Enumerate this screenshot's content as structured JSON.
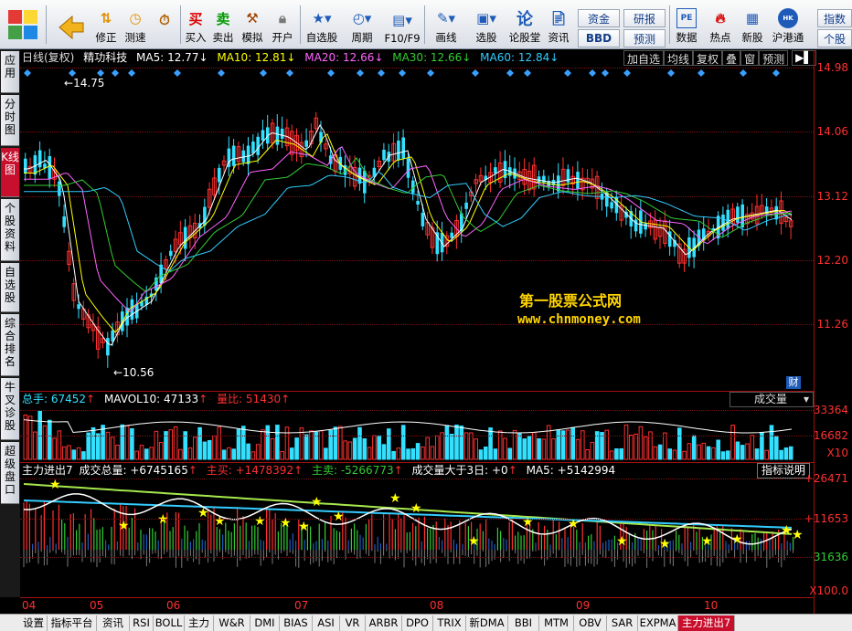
{
  "toolbar": {
    "buttons": [
      {
        "label": "修正",
        "icon": "arrow-updown-icon"
      },
      {
        "label": "测速",
        "icon": "speed-icon"
      },
      {
        "label": "买入",
        "icon": "buy-icon"
      },
      {
        "label": "卖出",
        "icon": "sell-icon"
      },
      {
        "label": "模拟",
        "icon": "hammer-icon"
      },
      {
        "label": "开户",
        "icon": "lock-icon"
      },
      {
        "label": "自选股",
        "icon": "star-icon"
      },
      {
        "label": "周期",
        "icon": "clock-icon"
      },
      {
        "label": "F10/F9",
        "icon": "f10-icon"
      },
      {
        "label": "画线",
        "icon": "pen-icon"
      },
      {
        "label": "选股",
        "icon": "screen-icon"
      },
      {
        "label": "论股堂",
        "icon": "forum-icon"
      },
      {
        "label": "资讯",
        "icon": "news-icon"
      },
      {
        "label": "数据",
        "icon": "pe-icon"
      },
      {
        "label": "热点",
        "icon": "hot-icon"
      },
      {
        "label": "新股",
        "icon": "new-stock-icon"
      },
      {
        "label": "沪港通",
        "icon": "sse-hkex-icon"
      }
    ],
    "box_zijin": "资金",
    "box_bbd": "BBD",
    "box_yanbao": "研报",
    "box_yuce": "预测",
    "box_zhishu": "指数",
    "box_gegu": "个股"
  },
  "left_tabs": [
    "应用",
    "分时图",
    "K线图",
    "个股资料",
    "自选股",
    "综合排名",
    "牛叉诊股",
    "超级盘口"
  ],
  "kline": {
    "header": {
      "period": "日线(复权)",
      "name": "精功科技",
      "ma5": "MA5: 12.77",
      "ma10": "MA10: 12.81",
      "ma20": "MA20: 12.66",
      "ma30": "MA30: 12.66",
      "ma60": "MA60: 12.84"
    },
    "right_buttons": [
      "加自选",
      "均线",
      "复权",
      "叠",
      "窗",
      "预测"
    ],
    "y_ticks": [
      "14.98",
      "14.06",
      "13.12",
      "12.20",
      "11.26"
    ],
    "high_label": "14.75",
    "low_label": "10.56",
    "watermark_title": "第一股票公式网",
    "watermark_url": "www.chnmoney.com",
    "cai_label": "财"
  },
  "volume": {
    "header": {
      "total": "总手: 67452",
      "mavol": "MAVOL10: 47133",
      "ratio": "量比: 51430"
    },
    "dropdown": "成交量",
    "y_ticks": [
      "33364",
      "16682",
      "X10"
    ]
  },
  "indicator": {
    "header": {
      "name": "主力进出7",
      "total": "成交总量: +6745165",
      "buy": "主买: +1478392",
      "sell": "主卖: -5266773",
      "big": "成交量大于3日: +0",
      "ma5": "MA5: +5142994"
    },
    "help_button": "指标说明",
    "y_ticks": [
      "+26471",
      "+11653",
      "31636",
      "X100.0"
    ]
  },
  "x_axis": [
    "04",
    "05",
    "06",
    "07",
    "08",
    "09",
    "10"
  ],
  "bottom_tabs": [
    "设置",
    "指标平台",
    "资讯",
    "RSI",
    "BOLL",
    "主力",
    "W&R",
    "DMI",
    "BIAS",
    "ASI",
    "VR",
    "ARBR",
    "DPO",
    "TRIX",
    "新DMA",
    "BBI",
    "MTM",
    "OBV",
    "SAR",
    "EXPMA",
    "主力进出7"
  ],
  "colors": {
    "up": "#ff3030",
    "down": "#33e0ff",
    "ma5": "#ffffff",
    "ma10": "#ffff00",
    "ma20": "#ff66ff",
    "ma30": "#33cc33",
    "ma60": "#33ccff",
    "axis": "#a01010"
  }
}
